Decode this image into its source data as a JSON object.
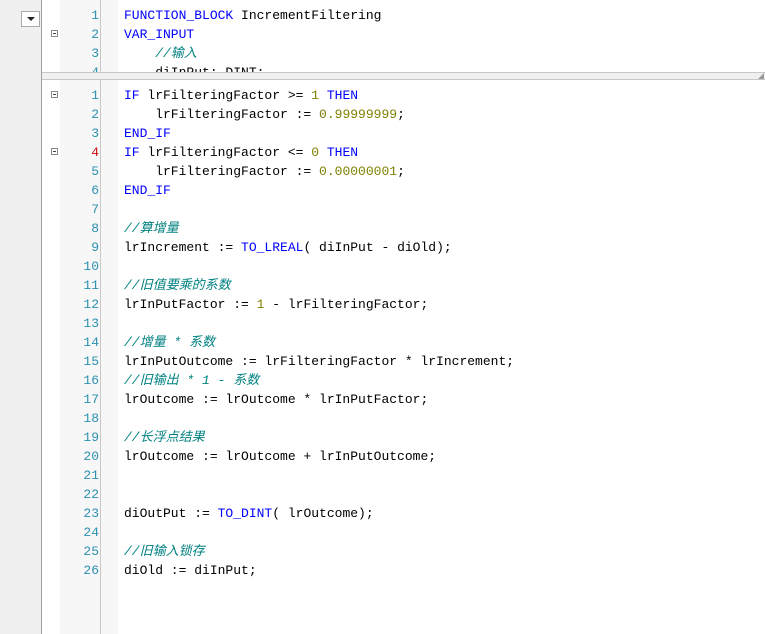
{
  "top_pane": {
    "lines": [
      {
        "num": "1",
        "parts": [
          {
            "t": "FUNCTION_BLOCK",
            "c": "kw"
          },
          {
            "t": " IncrementFiltering",
            "c": ""
          }
        ]
      },
      {
        "num": "2",
        "fold": true,
        "parts": [
          {
            "t": "VAR_INPUT",
            "c": "kw"
          }
        ]
      },
      {
        "num": "3",
        "parts": [
          {
            "t": "    //输入",
            "c": "cmt"
          }
        ]
      },
      {
        "num": "4",
        "parts": [
          {
            "t": "    diInPut: DINT;",
            "c": ""
          }
        ]
      }
    ]
  },
  "bottom_pane": {
    "lines": [
      {
        "num": "1",
        "fold": true,
        "parts": [
          {
            "t": "IF",
            "c": "kw"
          },
          {
            "t": " lrFilteringFactor >= ",
            "c": ""
          },
          {
            "t": "1",
            "c": "num"
          },
          {
            "t": " ",
            "c": ""
          },
          {
            "t": "THEN",
            "c": "kw"
          }
        ]
      },
      {
        "num": "2",
        "parts": [
          {
            "t": "    lrFilteringFactor := ",
            "c": ""
          },
          {
            "t": "0.99999999",
            "c": "num"
          },
          {
            "t": ";",
            "c": ""
          }
        ]
      },
      {
        "num": "3",
        "parts": [
          {
            "t": "END_IF",
            "c": "kw"
          }
        ]
      },
      {
        "num": "4",
        "bp": true,
        "fold": true,
        "parts": [
          {
            "t": "IF",
            "c": "kw"
          },
          {
            "t": " lrFilteringFactor <= ",
            "c": ""
          },
          {
            "t": "0",
            "c": "num"
          },
          {
            "t": " ",
            "c": ""
          },
          {
            "t": "THEN",
            "c": "kw"
          }
        ]
      },
      {
        "num": "5",
        "parts": [
          {
            "t": "    lrFilteringFactor := ",
            "c": ""
          },
          {
            "t": "0.00000001",
            "c": "num"
          },
          {
            "t": ";",
            "c": ""
          }
        ]
      },
      {
        "num": "6",
        "parts": [
          {
            "t": "END_IF",
            "c": "kw"
          }
        ]
      },
      {
        "num": "7",
        "parts": []
      },
      {
        "num": "8",
        "parts": [
          {
            "t": "//算增量",
            "c": "cmt"
          }
        ]
      },
      {
        "num": "9",
        "parts": [
          {
            "t": "lrIncrement := ",
            "c": ""
          },
          {
            "t": "TO_LREAL",
            "c": "kw"
          },
          {
            "t": "( diInPut - diOld);",
            "c": ""
          }
        ]
      },
      {
        "num": "10",
        "parts": []
      },
      {
        "num": "11",
        "parts": [
          {
            "t": "//旧值要乘的系数",
            "c": "cmt"
          }
        ]
      },
      {
        "num": "12",
        "parts": [
          {
            "t": "lrInPutFactor := ",
            "c": ""
          },
          {
            "t": "1",
            "c": "num"
          },
          {
            "t": " - lrFilteringFactor;",
            "c": ""
          }
        ]
      },
      {
        "num": "13",
        "parts": []
      },
      {
        "num": "14",
        "parts": [
          {
            "t": "//增量 * 系数",
            "c": "cmt"
          }
        ]
      },
      {
        "num": "15",
        "parts": [
          {
            "t": "lrInPutOutcome := lrFilteringFactor * lrIncrement;",
            "c": ""
          }
        ]
      },
      {
        "num": "16",
        "parts": [
          {
            "t": "//旧输出 * 1 - 系数",
            "c": "cmt"
          }
        ]
      },
      {
        "num": "17",
        "parts": [
          {
            "t": "lrOutcome := lrOutcome * lrInPutFactor;",
            "c": ""
          }
        ]
      },
      {
        "num": "18",
        "parts": []
      },
      {
        "num": "19",
        "parts": [
          {
            "t": "//长浮点结果",
            "c": "cmt"
          }
        ]
      },
      {
        "num": "20",
        "parts": [
          {
            "t": "lrOutcome := lrOutcome + lrInPutOutcome;",
            "c": ""
          }
        ]
      },
      {
        "num": "21",
        "parts": []
      },
      {
        "num": "22",
        "parts": []
      },
      {
        "num": "23",
        "parts": [
          {
            "t": "diOutPut := ",
            "c": ""
          },
          {
            "t": "TO_DINT",
            "c": "kw"
          },
          {
            "t": "( lrOutcome);",
            "c": ""
          }
        ]
      },
      {
        "num": "24",
        "parts": []
      },
      {
        "num": "25",
        "parts": [
          {
            "t": "//旧输入锁存",
            "c": "cmt"
          }
        ]
      },
      {
        "num": "26",
        "parts": [
          {
            "t": "diOld := diInPut;",
            "c": ""
          }
        ]
      }
    ]
  }
}
